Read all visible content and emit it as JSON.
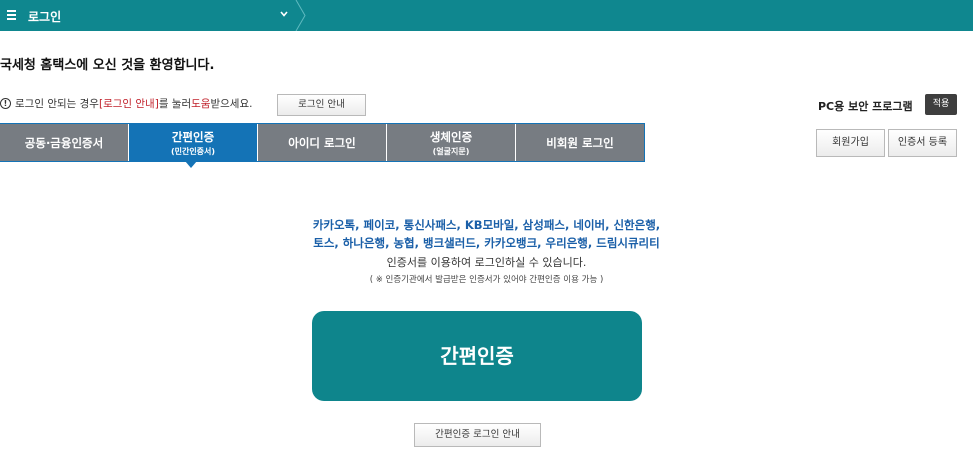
{
  "topbar": {
    "menu_title": "로그인",
    "icons": {
      "menu": "hamburger-icon",
      "dropdown": "chevron-down-icon"
    },
    "color": "#0f878f"
  },
  "welcome": "국세청 홈택스에 오신 것을 환영합니다.",
  "notice": {
    "prefix": "로그인 안되는 경우 ",
    "link": "[로그인 안내]",
    "middle": "를 눌러 ",
    "help": "도움",
    "suffix": "받으세요.",
    "guide_button": "로그인 안내"
  },
  "security": {
    "label": "PC용 보안 프로그램",
    "apply_button": "적용"
  },
  "tabs": [
    {
      "label": "공동·금융인증서",
      "sub": ""
    },
    {
      "label": "간편인증",
      "sub": "(민간인증서)"
    },
    {
      "label": "아이디 로그인",
      "sub": ""
    },
    {
      "label": "생체인증",
      "sub": "(얼굴지문)"
    },
    {
      "label": "비회원 로그인",
      "sub": ""
    }
  ],
  "active_tab": 1,
  "actions": {
    "join": "회원가입",
    "cert_register": "인증서 등록"
  },
  "content": {
    "providers_line1": "카카오톡, 페이코, 통신사패스, KB모바일, 삼성패스, 네이버, 신한은행,",
    "providers_line2": "토스, 하나은행, 농협, 뱅크샐러드, 카카오뱅크, 우리은행, 드림시큐리티",
    "desc": "인증서를 이용하여 로그인하실 수 있습니다.",
    "note": "( ※ 인증기관에서 발급받은 인증서가 있어야 간편인증 이용 가능 )",
    "main_button": "간편인증",
    "guide_button": "간편인증 로그인 안내"
  },
  "colors": {
    "tab_active": "#1473b6",
    "tab_inactive": "#777c82",
    "primary": "#0e858c"
  }
}
